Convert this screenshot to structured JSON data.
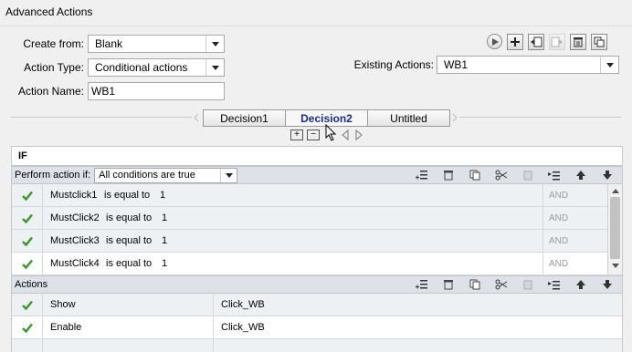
{
  "window": {
    "title": "Advanced Actions"
  },
  "form": {
    "create_from": {
      "label": "Create from:",
      "value": "Blank"
    },
    "action_type": {
      "label": "Action Type:",
      "value": "Conditional actions"
    },
    "action_name": {
      "label": "Action Name:",
      "value": "WB1"
    },
    "existing_actions": {
      "label": "Existing Actions:",
      "value": "WB1"
    }
  },
  "toolbar": {
    "icons": [
      "preview-icon",
      "add-icon",
      "import-icon",
      "export-icon",
      "delete-icon",
      "duplicate-icon"
    ]
  },
  "tabs": [
    {
      "label": "Decision1",
      "active": false
    },
    {
      "label": "Decision2",
      "active": true
    },
    {
      "label": "Untitled",
      "active": false
    }
  ],
  "if_section": {
    "header": "IF",
    "perform_label": "Perform action if:",
    "condition_mode": "All conditions are true",
    "rows": [
      {
        "variable": "Mustclick1",
        "operator": "is equal to",
        "value": "1",
        "logic": "AND"
      },
      {
        "variable": "MustClick2",
        "operator": "is equal to",
        "value": "1",
        "logic": "AND"
      },
      {
        "variable": "MustClick3",
        "operator": "is equal to",
        "value": "1",
        "logic": "AND"
      },
      {
        "variable": "MustClick4",
        "operator": "is equal to",
        "value": "1",
        "logic": "AND"
      }
    ]
  },
  "actions_section": {
    "header": "Actions",
    "rows": [
      {
        "action": "Show",
        "target": "Click_WB"
      },
      {
        "action": "Enable",
        "target": "Click_WB"
      }
    ]
  },
  "colors": {
    "active_tab": "#1a2a9c",
    "check": "#3a9a2a",
    "bar": "#dde2e8"
  }
}
